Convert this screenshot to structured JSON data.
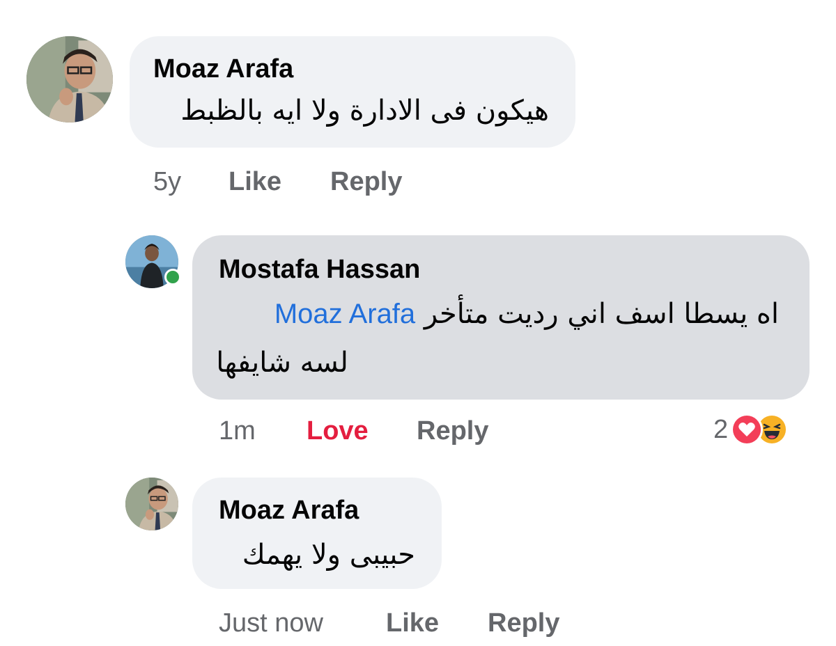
{
  "comments": [
    {
      "author": "Moaz Arafa",
      "text": "هيكون فى الادارة ولا ايه بالظبط",
      "time": "5y",
      "like_label": "Like",
      "reply_label": "Reply"
    },
    {
      "author": "Mostafa Hassan",
      "text_line1": "اه يسطا اسف اني رديت متأخر",
      "mention": "Moaz Arafa",
      "text_line2": "لسه شايفها",
      "time": "1m",
      "love_label": "Love",
      "reply_label": "Reply",
      "reaction_count": "2",
      "reaction_icons": [
        "heart-icon",
        "haha-icon"
      ],
      "online": true
    },
    {
      "author": "Moaz Arafa",
      "text": "حبيبى ولا يهمك",
      "time": "Just now",
      "like_label": "Like",
      "reply_label": "Reply"
    }
  ],
  "colors": {
    "bubble": "#f0f2f5",
    "selected_bubble": "#dcdee2",
    "mention": "#216fdb",
    "love": "#e41e3f",
    "meta": "#65676b",
    "online": "#31a24c"
  }
}
